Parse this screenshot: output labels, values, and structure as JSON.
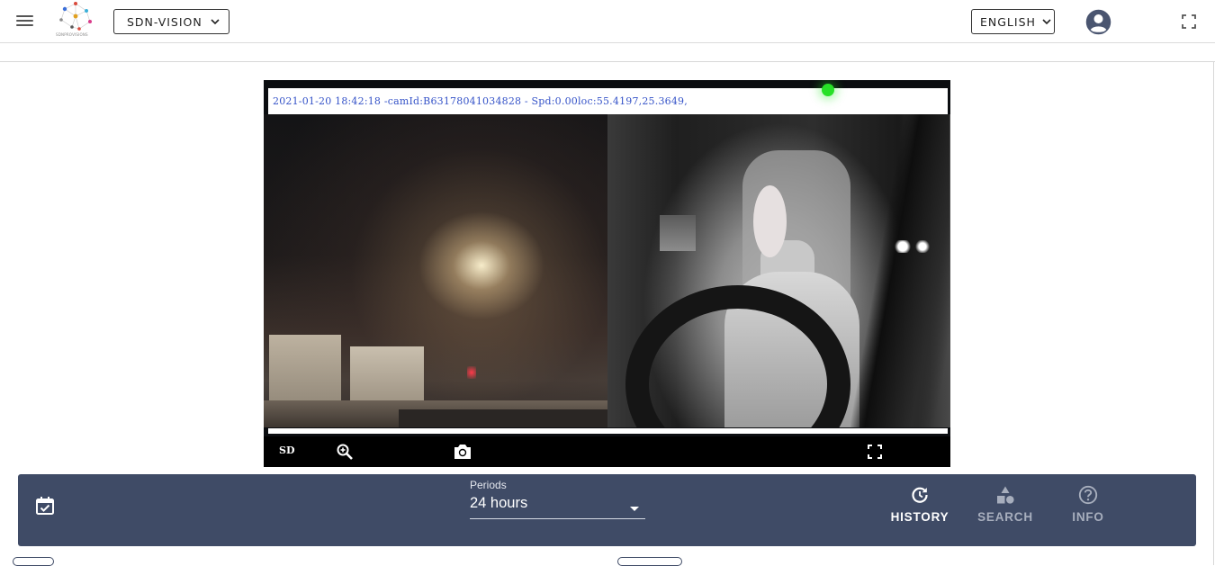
{
  "header": {
    "menu_icon": "hamburger-menu-icon",
    "logo_icon": "network-logo-icon",
    "logo_text": "SDNPROVISIONS",
    "app_selector": {
      "value": "SDN-VISION",
      "icon": "chevron-down-icon"
    },
    "language_selector": {
      "value": "ENGLISH",
      "icon": "chevron-down-icon"
    },
    "account_icon": "account-circle-icon",
    "fullscreen_icon": "fullscreen-icon"
  },
  "video": {
    "overlay_text": "2021-01-20 18:42:18 -camId:B63178041034828 - Spd:0.00loc:55.4197,25.3649,",
    "status_indicator_color": "#27e027",
    "progress_percent": 100,
    "controls": {
      "quality_label": "SD",
      "zoom_icon": "zoom-in-icon",
      "snapshot_icon": "camera-icon",
      "fullscreen_icon": "fullscreen-icon"
    }
  },
  "bottom_bar": {
    "background_color": "#3f4b66",
    "calendar_icon": "calendar-check-icon",
    "periods": {
      "label": "Periods",
      "value": "24 hours",
      "icon": "dropdown-arrow-icon"
    },
    "nav": [
      {
        "label": "HISTORY",
        "icon": "history-icon",
        "active": true
      },
      {
        "label": "SEARCH",
        "icon": "shapes-icon",
        "active": false
      },
      {
        "label": "INFO",
        "icon": "help-circle-icon",
        "active": false
      }
    ]
  }
}
